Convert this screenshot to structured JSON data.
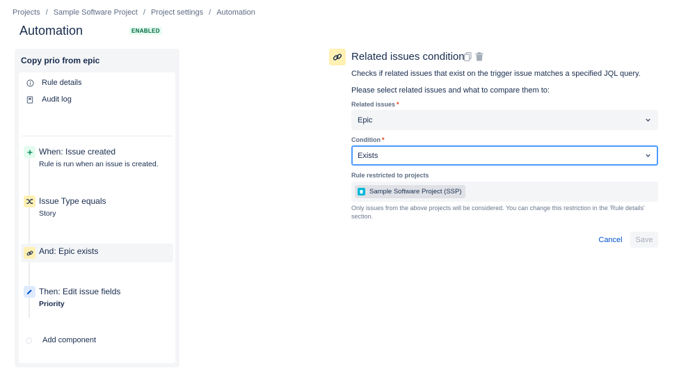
{
  "breadcrumb": [
    "Projects",
    "Sample Software Project",
    "Project settings",
    "Automation"
  ],
  "breadcrumb_separator": "/",
  "page": {
    "title": "Automation",
    "status": "ENABLED"
  },
  "rule": {
    "name": "Copy prio from epic",
    "nav": [
      {
        "label": "Rule details",
        "icon": "info-icon"
      },
      {
        "label": "Audit log",
        "icon": "document-icon"
      }
    ],
    "steps": [
      {
        "title": "When: Issue created",
        "subtitle": "Rule is run when an issue is created.",
        "icon": "plus-icon",
        "color": "#e3fcef",
        "selected": false
      },
      {
        "title": "Issue Type equals",
        "subtitle": "Story",
        "icon": "shuffle-icon",
        "color": "#fff0b3",
        "selected": false
      },
      {
        "title": "And: Epic exists",
        "subtitle": "",
        "icon": "link-icon",
        "color": "#fff0b3",
        "selected": true
      },
      {
        "title": "Then: Edit issue fields",
        "subtitle": "Priority",
        "icon": "pencil-icon",
        "color": "#deebff",
        "selected": false
      }
    ],
    "add_component": "Add component"
  },
  "condition": {
    "title": "Related issues condition",
    "description": "Checks if related issues that exist on the trigger issue matches a specified JQL query.",
    "instruction": "Please select related issues and what to compare them to:",
    "related_issues": {
      "label": "Related issues",
      "required": "*",
      "value": "Epic"
    },
    "condition_field": {
      "label": "Condition",
      "required": "*",
      "value": "Exists"
    },
    "restricted": {
      "label": "Rule restricted to projects",
      "project": "Sample Software Project (SSP)",
      "help": "Only issues from the above projects will be considered. You can change this restriction in the 'Rule details' section."
    },
    "cancel_label": "Cancel",
    "save_label": "Save"
  },
  "colors": {
    "accent": "#0052cc",
    "focus": "#4c9aff",
    "enabled_bg": "#e3fcef",
    "enabled_text": "#006644"
  }
}
